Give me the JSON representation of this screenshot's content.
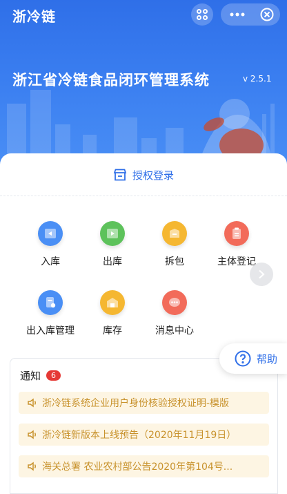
{
  "header": {
    "app_title": "浙冷链",
    "system_title": "浙江省冷链食品闭环管理系统",
    "version": "v 2.5.1"
  },
  "auth": {
    "label": "授权登录"
  },
  "grid": [
    {
      "label": "入库",
      "icon": "inbound-icon",
      "color": "#4a8ff5"
    },
    {
      "label": "出库",
      "icon": "outbound-icon",
      "color": "#5dc25b"
    },
    {
      "label": "拆包",
      "icon": "unpack-icon",
      "color": "#f5b731"
    },
    {
      "label": "主体登记",
      "icon": "entity-register-icon",
      "color": "#f26b5a"
    },
    {
      "label": "出入库管理",
      "icon": "inout-manage-icon",
      "color": "#4a8ff5"
    },
    {
      "label": "库存",
      "icon": "inventory-icon",
      "color": "#f5b731"
    },
    {
      "label": "消息中心",
      "icon": "message-icon",
      "color": "#f26b5a"
    }
  ],
  "help": {
    "label": "帮助"
  },
  "notice": {
    "title": "通知",
    "count": "6",
    "items": [
      "浙冷链系统企业用户身份核验授权证明-模版",
      "浙冷链新版本上线预告（2020年11月19日）",
      "海关总署 农业农村部公告2020年第104号..."
    ]
  }
}
